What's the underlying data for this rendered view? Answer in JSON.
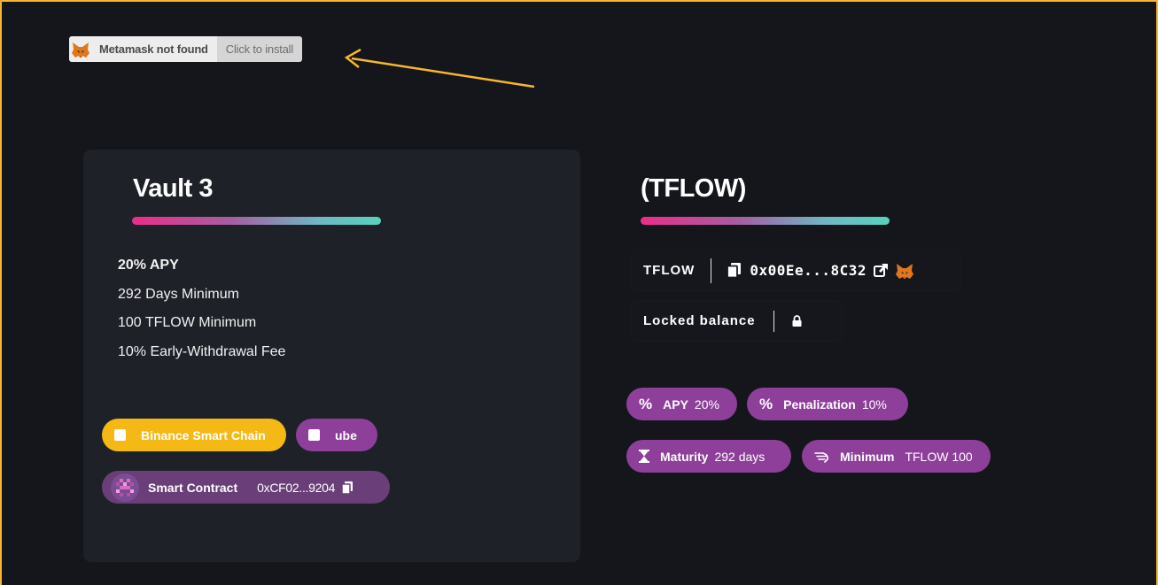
{
  "banner": {
    "not_found": "Metamask not found",
    "install": "Click to install"
  },
  "vault": {
    "title": "Vault 3",
    "info": [
      "20% APY",
      "292 Days Minimum",
      "100 TFLOW Minimum",
      "10% Early-Withdrawal Fee"
    ],
    "chains": {
      "bsc": "Binance Smart Chain",
      "ube": "ube"
    },
    "contract": {
      "label": "Smart Contract",
      "address": "0xCF02...9204"
    }
  },
  "token": {
    "title": "(TFLOW)",
    "symbol": "TFLOW",
    "address": "0x00Ee...8C32",
    "locked_label": "Locked balance"
  },
  "tags": {
    "apy": {
      "label": "APY",
      "value": "20%"
    },
    "penalization": {
      "label": "Penalization",
      "value": "10%"
    },
    "maturity": {
      "label": "Maturity",
      "value": "292 days"
    },
    "minimum": {
      "label": "Minimum",
      "value": "TFLOW 100"
    }
  },
  "colors": {
    "accent_yellow": "#f5b915",
    "accent_purple": "#8d3f9a",
    "background": "#14161b",
    "card": "#1f2129"
  }
}
